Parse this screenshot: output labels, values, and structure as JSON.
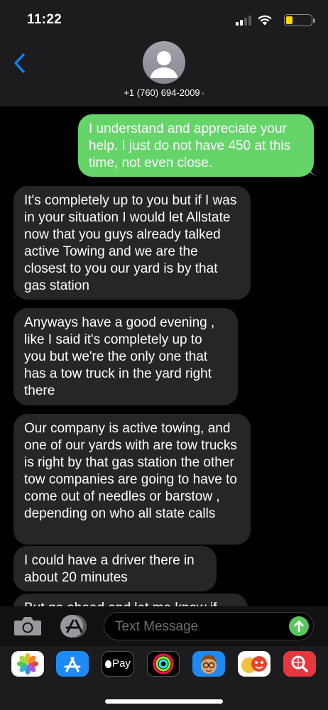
{
  "status_bar": {
    "time": "11:22",
    "battery_level": 0.25
  },
  "header": {
    "contact": "+1 (760) 694-2009",
    "chevron": "›"
  },
  "messages": [
    {
      "type": "sent",
      "text": "I understand and appreciate your help. I just do not have 450 at this time, not even close."
    },
    {
      "type": "received",
      "text": "It's completely up to you but if I was in your situation I would let Allstate now that you guys already talked active Towing and we are the closest to you our yard is by that gas station"
    },
    {
      "type": "received",
      "text": "Anyways have a good evening , like I said it's completely up to you but we're the only one that has a tow truck in the yard right there"
    },
    {
      "type": "received",
      "text": "Our company is active towing, and  one of our yards with are tow trucks is right by that gas station the other tow companies are going to have to come out of needles or barstow , depending on who all state calls"
    },
    {
      "type": "received",
      "text": "I could have a driver there in about 20 minutes"
    },
    {
      "type": "received",
      "text": "But go ahead and let me know if"
    }
  ],
  "compose": {
    "placeholder": "Text Message"
  },
  "app_drawer": {
    "apple_pay_label": "Pay",
    "apps": [
      "photos-icon",
      "app-store-icon",
      "apple-pay-icon",
      "activity-icon",
      "memoji-icon",
      "animoji-icon",
      "search-images-icon"
    ]
  },
  "colors": {
    "sent_bubble": "#65d56a",
    "received_bubble": "#262629",
    "accent": "#0a84ff"
  }
}
